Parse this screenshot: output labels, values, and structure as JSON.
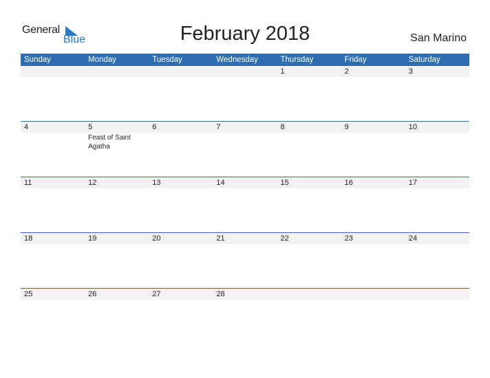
{
  "logo": {
    "general": "General",
    "blue": "Blue"
  },
  "title": "February 2018",
  "country": "San Marino",
  "colors": {
    "header": "#2e6eb0",
    "strip": "#f2f2f2",
    "brand_blue": "#2a77c6"
  },
  "weekdays": [
    "Sunday",
    "Monday",
    "Tuesday",
    "Wednesday",
    "Thursday",
    "Friday",
    "Saturday"
  ],
  "weeks": [
    [
      {
        "day": ""
      },
      {
        "day": ""
      },
      {
        "day": ""
      },
      {
        "day": ""
      },
      {
        "day": "1"
      },
      {
        "day": "2"
      },
      {
        "day": "3"
      }
    ],
    [
      {
        "day": "4"
      },
      {
        "day": "5",
        "event": "Feast of Saint Agatha"
      },
      {
        "day": "6"
      },
      {
        "day": "7"
      },
      {
        "day": "8"
      },
      {
        "day": "9"
      },
      {
        "day": "10"
      }
    ],
    [
      {
        "day": "11"
      },
      {
        "day": "12"
      },
      {
        "day": "13"
      },
      {
        "day": "14"
      },
      {
        "day": "15"
      },
      {
        "day": "16"
      },
      {
        "day": "17"
      }
    ],
    [
      {
        "day": "18"
      },
      {
        "day": "19"
      },
      {
        "day": "20"
      },
      {
        "day": "21"
      },
      {
        "day": "22"
      },
      {
        "day": "23"
      },
      {
        "day": "24"
      }
    ],
    [
      {
        "day": "25"
      },
      {
        "day": "26"
      },
      {
        "day": "27"
      },
      {
        "day": "28"
      },
      {
        "day": ""
      },
      {
        "day": ""
      },
      {
        "day": ""
      }
    ]
  ]
}
